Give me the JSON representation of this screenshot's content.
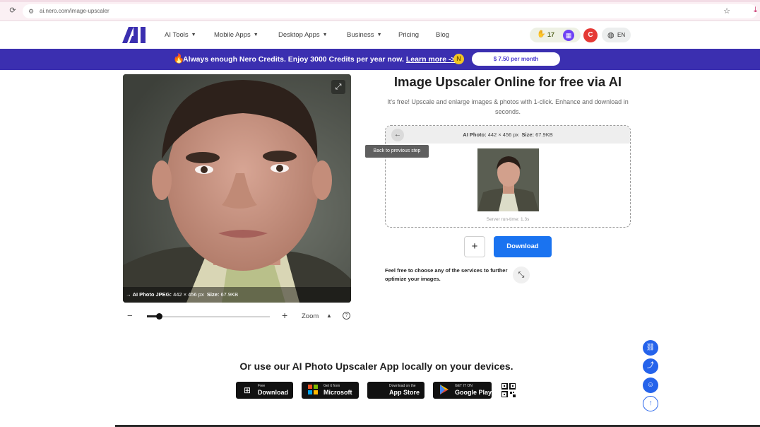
{
  "browser": {
    "url": "ai.nero.com/image-upscaler"
  },
  "nav": {
    "items": [
      {
        "label": "AI Tools",
        "has_caret": true
      },
      {
        "label": "Mobile Apps",
        "has_caret": true
      },
      {
        "label": "Desktop Apps",
        "has_caret": true
      },
      {
        "label": "Business",
        "has_caret": true
      },
      {
        "label": "Pricing",
        "has_caret": false
      },
      {
        "label": "Blog",
        "has_caret": false
      }
    ],
    "credits": "17",
    "avatar_letter": "C",
    "language": "EN"
  },
  "banner": {
    "text": "Always enough Nero Credits. Enjoy 3000 Credits per year now.",
    "link": "Learn more ->",
    "price": "$ 7.50 per month"
  },
  "preview": {
    "caption_label": "AI Photo JPEG:",
    "caption_dims": "442 × 456 px",
    "caption_size_label": "Size:",
    "caption_size": "67.9KB"
  },
  "zoom": {
    "label": "Zoom",
    "level_fraction": 0.1
  },
  "main": {
    "title": "Image Upscaler Online for free via AI",
    "subtitle": "It's free! Upscale and enlarge images & photos with 1-click. Enhance and download in seconds."
  },
  "result": {
    "meta_label": "AI Photo:",
    "dims": "442 × 456 px",
    "size_label": "Size:",
    "size": "67.9KB",
    "runtime": "Server run-time: 1.3s",
    "tooltip": "Back to previous step"
  },
  "actions": {
    "add": "+",
    "download": "Download",
    "hint": "Feel free to choose any of the services to further optimize your images."
  },
  "apps": {
    "title": "Or use our AI Photo Upscaler App locally on your devices.",
    "stores": [
      {
        "small": "Free",
        "big": "Download",
        "icon": "windows-icon"
      },
      {
        "small": "Get it from",
        "big": "Microsoft",
        "icon": "microsoft-icon"
      },
      {
        "small": "Download on the",
        "big": "App Store",
        "icon": "apple-icon"
      },
      {
        "small": "GET IT ON",
        "big": "Google Play",
        "icon": "google-play-icon"
      }
    ]
  },
  "colors": {
    "brand": "#3b2fb0",
    "primary_button": "#1a73f0",
    "avatar": "#e53935"
  }
}
